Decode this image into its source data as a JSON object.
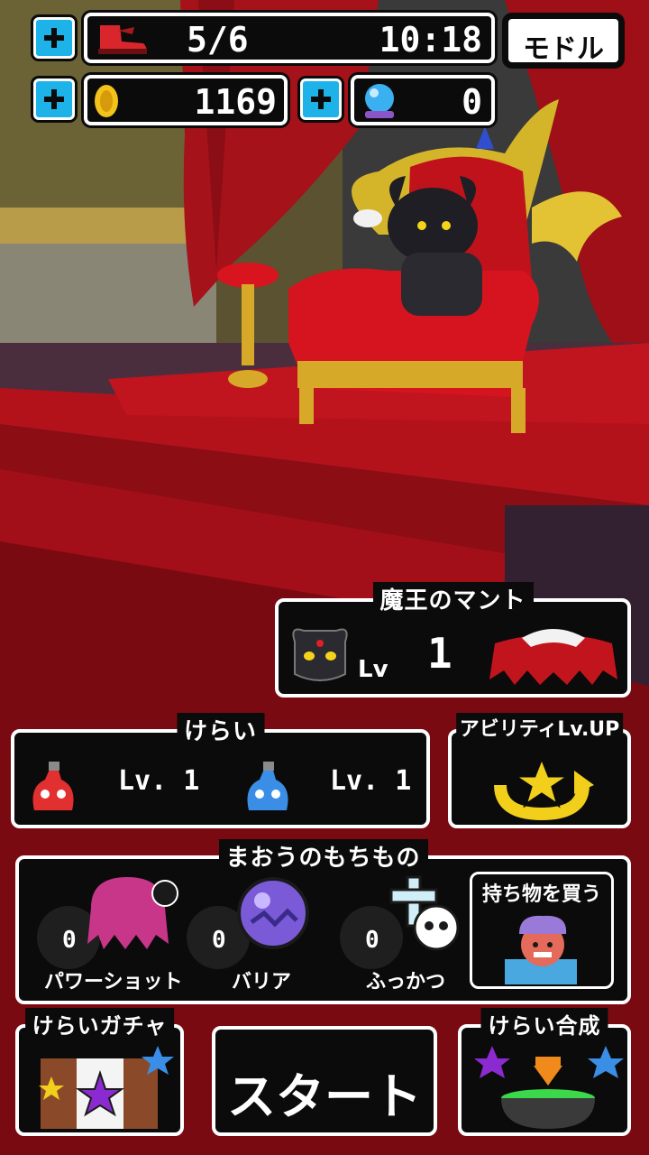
{
  "status": {
    "stamina": "5/6",
    "timer": "10:18",
    "back_label": "モドル",
    "coins": "1169",
    "gems": "0"
  },
  "mantle": {
    "title": "魔王のマント",
    "lv_label": "Lv",
    "level": "1"
  },
  "servants": {
    "title": "けらい",
    "items": [
      {
        "level": "Lv. 1"
      },
      {
        "level": "Lv. 1"
      }
    ]
  },
  "ability": {
    "title": "アビリティLv.UP"
  },
  "items": {
    "title": "まおうのもちもの",
    "list": [
      {
        "count": "0",
        "label": "パワーショット"
      },
      {
        "count": "0",
        "label": "バリア"
      },
      {
        "count": "0",
        "label": "ふっかつ"
      }
    ],
    "buy_label": "持ち物を買う"
  },
  "gacha": {
    "title": "けらいガチャ"
  },
  "start": {
    "label": "スタート"
  },
  "fusion": {
    "title": "けらい合成"
  }
}
